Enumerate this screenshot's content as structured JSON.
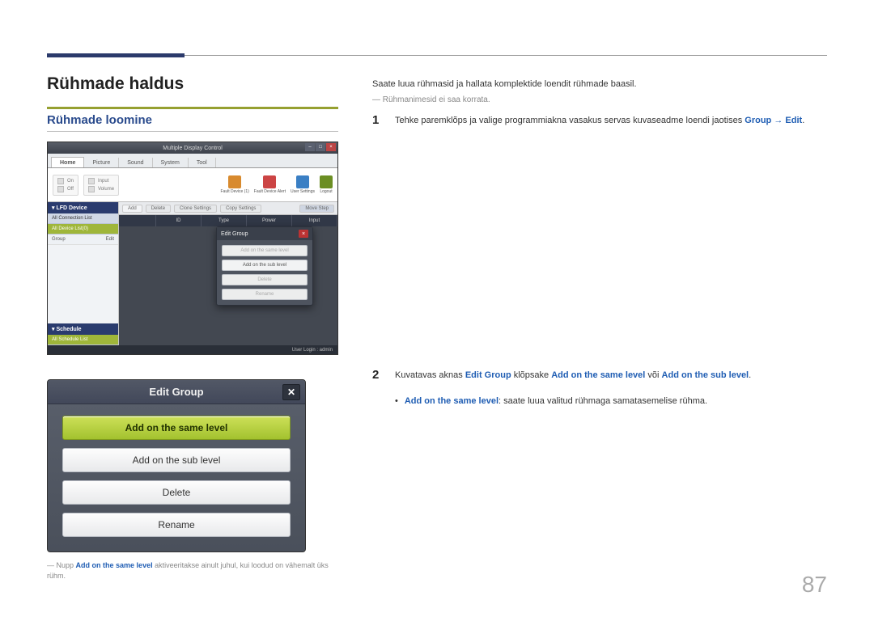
{
  "page_number": "87",
  "heading": "Rühmade haldus",
  "subheading": "Rühmade loomine",
  "intro": "Saate luua rühmasid ja hallata komplektide loendit rühmade baasil.",
  "note_prefix": "―",
  "note": "Rühmanimesid ei saa korrata.",
  "steps": [
    {
      "num": "1",
      "text_before": "Tehke paremklõps ja valige programmiakna vasakus servas kuvaseadme loendi jaotises ",
      "link1": "Group",
      "arrow": " → ",
      "link2": "Edit",
      "text_after": "."
    },
    {
      "num": "2",
      "text_before": "Kuvatavas aknas ",
      "link1": "Edit Group",
      "mid1": " klõpsake ",
      "link2": "Add on the same level",
      "mid2": " või ",
      "link3": "Add on the sub level",
      "text_after": "."
    }
  ],
  "bullet": {
    "label": "Add on the same level",
    "desc": ": saate luua valitud rühmaga samatasemelise rühma."
  },
  "footnote": {
    "prefix": "―",
    "pre": "Nupp ",
    "bold": "Add on the same level",
    "post": " aktiveeritakse ainult juhul, kui loodud on vähemalt üks rühm."
  },
  "shot1": {
    "app_title": "Multiple Display Control",
    "tabs": [
      "Home",
      "Picture",
      "Sound",
      "System",
      "Tool"
    ],
    "toolgroup_labels": {
      "a": "On",
      "b": "Off",
      "c": "Input",
      "d": "Volume"
    },
    "toolicons": [
      {
        "name": "fault-device-icon",
        "label": "Fault Device (1)",
        "color": "#d88a2e"
      },
      {
        "name": "fault-device-alert-icon",
        "label": "Fault Device Alert",
        "color": "#cc4444"
      },
      {
        "name": "user-settings-icon",
        "label": "User Settings",
        "color": "#3a7fc4"
      },
      {
        "name": "logout-icon",
        "label": "Logout",
        "color": "#6b8e23"
      }
    ],
    "side": {
      "hdr1": "▾ LFD Device",
      "row_all": "All Connection List",
      "row_sel": "All Device List(0)",
      "sub_left": "Group",
      "sub_right": "Edit",
      "hdr2": "▾ Schedule",
      "row_sched": "All Schedule List"
    },
    "actions": [
      "Add",
      "Delete",
      "Clone Settings",
      "Copy Settings"
    ],
    "action_right": "Move Step",
    "thead": [
      "",
      "ID",
      "Type",
      "Power",
      "Input"
    ],
    "modal": {
      "title": "Edit Group",
      "items": [
        "Add on the same level",
        "Add on the sub level",
        "Delete",
        "Rename"
      ]
    },
    "status": "User Login : admin"
  },
  "shot2": {
    "title": "Edit Group",
    "buttons": [
      "Add on the same level",
      "Add on the sub level",
      "Delete",
      "Rename"
    ]
  }
}
